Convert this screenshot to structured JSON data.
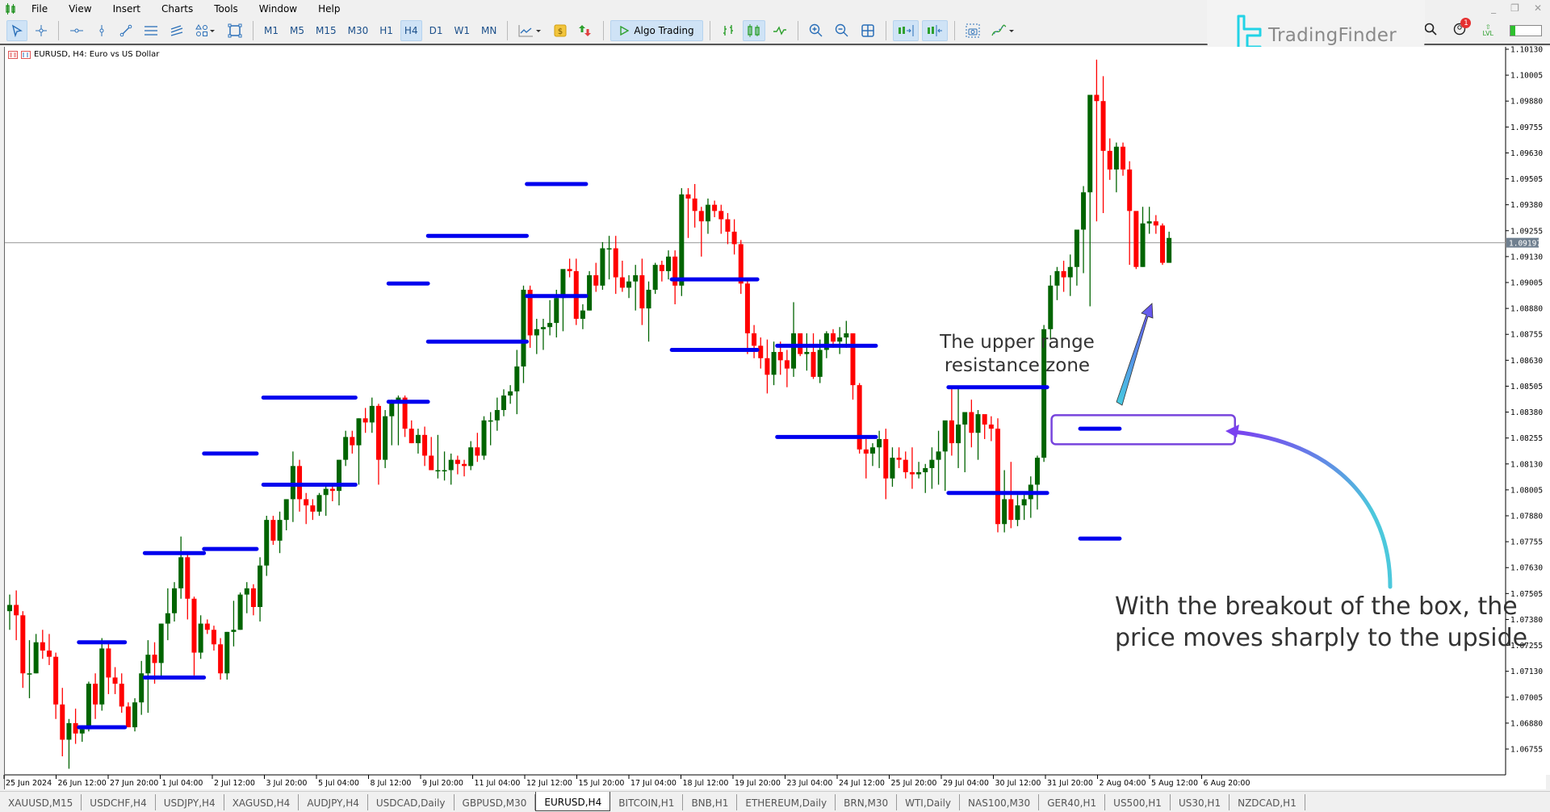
{
  "window": {
    "app_icon": "candles-app-icon",
    "menu": [
      "File",
      "View",
      "Insert",
      "Charts",
      "Tools",
      "Window",
      "Help"
    ],
    "controls": [
      "minimize",
      "restore",
      "close"
    ]
  },
  "toolbar": {
    "timeframes": [
      "M1",
      "M5",
      "M15",
      "M30",
      "H1",
      "H4",
      "D1",
      "W1",
      "MN"
    ],
    "active_timeframe": "H4",
    "algo_trading_label": "Algo Trading",
    "notification_count": "1",
    "level_label": "LVL",
    "level_fill": 0.15
  },
  "logo": {
    "text": "TradingFinder"
  },
  "chart": {
    "title": "EURUSD, H4:  Euro vs US Dollar",
    "current_price": "1.09197",
    "colors": {
      "bull": "#006400",
      "bear": "#ff0000",
      "range": "#0000ee",
      "box": "#7744dd",
      "price_line": "#a0a0a0"
    }
  },
  "chart_data": {
    "type": "candlestick",
    "symbol": "EURUSD",
    "timeframe": "H4",
    "ylim": [
      1.0663,
      1.1019
    ],
    "y_ticks": [
      "1.10130",
      "1.10005",
      "1.09880",
      "1.09755",
      "1.09630",
      "1.09505",
      "1.09380",
      "1.09255",
      "1.09130",
      "1.09005",
      "1.08880",
      "1.08755",
      "1.08630",
      "1.08505",
      "1.08380",
      "1.08255",
      "1.08130",
      "1.08005",
      "1.07880",
      "1.07755",
      "1.07630",
      "1.07505",
      "1.07380",
      "1.07255",
      "1.07130",
      "1.07005",
      "1.06880",
      "1.06755"
    ],
    "x_ticks": [
      "25 Jun 2024",
      "26 Jun 12:00",
      "27 Jun 20:00",
      "1 Jul 04:00",
      "2 Jul 12:00",
      "3 Jul 20:00",
      "5 Jul 04:00",
      "8 Jul 12:00",
      "9 Jul 20:00",
      "11 Jul 04:00",
      "12 Jul 12:00",
      "15 Jul 20:00",
      "17 Jul 04:00",
      "18 Jul 12:00",
      "19 Jul 20:00",
      "23 Jul 04:00",
      "24 Jul 12:00",
      "25 Jul 20:00",
      "29 Jul 04:00",
      "30 Jul 12:00",
      "31 Jul 20:00",
      "2 Aug 04:00",
      "5 Aug 12:00",
      "6 Aug 20:00"
    ],
    "candles": [
      [
        1.0742,
        1.075,
        1.0733,
        1.0745
      ],
      [
        1.0745,
        1.0752,
        1.0728,
        1.074
      ],
      [
        1.074,
        1.0742,
        1.0705,
        1.0712
      ],
      [
        1.0712,
        1.0728,
        1.07,
        1.0712
      ],
      [
        1.0712,
        1.0731,
        1.0712,
        1.0727
      ],
      [
        1.0727,
        1.0733,
        1.0719,
        1.0723
      ],
      [
        1.0723,
        1.0731,
        1.0716,
        1.072
      ],
      [
        1.072,
        1.0722,
        1.069,
        1.0697
      ],
      [
        1.0697,
        1.0705,
        1.0672,
        1.068
      ],
      [
        1.068,
        1.069,
        1.0666,
        1.0688
      ],
      [
        1.0688,
        1.0695,
        1.0678,
        1.0683
      ],
      [
        1.0683,
        1.0687,
        1.0679,
        1.0685
      ],
      [
        1.0685,
        1.0708,
        1.0684,
        1.0707
      ],
      [
        1.0707,
        1.0712,
        1.069,
        1.0697
      ],
      [
        1.0697,
        1.0729,
        1.0694,
        1.0724
      ],
      [
        1.0724,
        1.0727,
        1.0702,
        1.071
      ],
      [
        1.071,
        1.0715,
        1.0702,
        1.0707
      ],
      [
        1.0707,
        1.0712,
        1.0693,
        1.0696
      ],
      [
        1.0696,
        1.0698,
        1.0686,
        1.0686
      ],
      [
        1.0686,
        1.07,
        1.0684,
        1.0698
      ],
      [
        1.0698,
        1.0718,
        1.0692,
        1.0712
      ],
      [
        1.0712,
        1.0728,
        1.0693,
        1.0721
      ],
      [
        1.0721,
        1.0727,
        1.0707,
        1.0717
      ],
      [
        1.0717,
        1.0736,
        1.071,
        1.0736
      ],
      [
        1.0736,
        1.0753,
        1.0728,
        1.0741
      ],
      [
        1.0741,
        1.0756,
        1.0737,
        1.0753
      ],
      [
        1.0753,
        1.0778,
        1.0748,
        1.0768
      ],
      [
        1.0768,
        1.077,
        1.0738,
        1.0748
      ],
      [
        1.0748,
        1.0749,
        1.0711,
        1.0722
      ],
      [
        1.0722,
        1.074,
        1.0719,
        1.0736
      ],
      [
        1.0736,
        1.0738,
        1.0731,
        1.0733
      ],
      [
        1.0733,
        1.0735,
        1.0723,
        1.0726
      ],
      [
        1.0726,
        1.0729,
        1.0709,
        1.0712
      ],
      [
        1.0712,
        1.0732,
        1.0709,
        1.0732
      ],
      [
        1.0732,
        1.0747,
        1.0725,
        1.0733
      ],
      [
        1.0733,
        1.0751,
        1.0733,
        1.075
      ],
      [
        1.075,
        1.0756,
        1.0741,
        1.0753
      ],
      [
        1.0753,
        1.0755,
        1.074,
        1.0744
      ],
      [
        1.0744,
        1.0768,
        1.0737,
        1.0764
      ],
      [
        1.0764,
        1.0788,
        1.0759,
        1.0786
      ],
      [
        1.0786,
        1.0788,
        1.0774,
        1.0776
      ],
      [
        1.0776,
        1.079,
        1.077,
        1.0786
      ],
      [
        1.0786,
        1.0796,
        1.0781,
        1.0796
      ],
      [
        1.0796,
        1.0819,
        1.0785,
        1.0812
      ],
      [
        1.0812,
        1.0815,
        1.079,
        1.0796
      ],
      [
        1.0796,
        1.0799,
        1.0784,
        1.0793
      ],
      [
        1.0793,
        1.0796,
        1.0786,
        1.079
      ],
      [
        1.079,
        1.0799,
        1.0788,
        1.0798
      ],
      [
        1.0798,
        1.0802,
        1.0788,
        1.0801
      ],
      [
        1.0801,
        1.0803,
        1.0795,
        1.08
      ],
      [
        1.08,
        1.0815,
        1.0793,
        1.0815
      ],
      [
        1.0815,
        1.0829,
        1.0812,
        1.0826
      ],
      [
        1.0826,
        1.0829,
        1.0818,
        1.0822
      ],
      [
        1.0822,
        1.0835,
        1.0803,
        1.0835
      ],
      [
        1.0835,
        1.084,
        1.0828,
        1.0833
      ],
      [
        1.0833,
        1.0845,
        1.0828,
        1.0841
      ],
      [
        1.0841,
        1.0842,
        1.0803,
        1.0815
      ],
      [
        1.0815,
        1.0839,
        1.0811,
        1.0836
      ],
      [
        1.0836,
        1.0844,
        1.0822,
        1.0843
      ],
      [
        1.0843,
        1.0846,
        1.0822,
        1.0845
      ],
      [
        1.0845,
        1.0846,
        1.0826,
        1.083
      ],
      [
        1.083,
        1.0834,
        1.0823,
        1.0823
      ],
      [
        1.0823,
        1.083,
        1.0818,
        1.0827
      ],
      [
        1.0827,
        1.0831,
        1.0812,
        1.0817
      ],
      [
        1.0817,
        1.0826,
        1.081,
        1.081
      ],
      [
        1.081,
        1.0827,
        1.0806,
        1.081
      ],
      [
        1.081,
        1.0819,
        1.0805,
        1.081
      ],
      [
        1.081,
        1.0818,
        1.0803,
        1.0815
      ],
      [
        1.0815,
        1.0817,
        1.0808,
        1.0813
      ],
      [
        1.0813,
        1.0815,
        1.0807,
        1.0812
      ],
      [
        1.0812,
        1.0824,
        1.081,
        1.0821
      ],
      [
        1.0821,
        1.0828,
        1.0814,
        1.0817
      ],
      [
        1.0817,
        1.0836,
        1.0815,
        1.0834
      ],
      [
        1.0834,
        1.0838,
        1.0822,
        1.0834
      ],
      [
        1.0834,
        1.0845,
        1.0829,
        1.0839
      ],
      [
        1.0839,
        1.0849,
        1.0836,
        1.0846
      ],
      [
        1.0846,
        1.0851,
        1.0842,
        1.0848
      ],
      [
        1.0848,
        1.0868,
        1.0837,
        1.086
      ],
      [
        1.086,
        1.0899,
        1.0852,
        1.0897
      ],
      [
        1.0897,
        1.0899,
        1.0869,
        1.0875
      ],
      [
        1.0875,
        1.0883,
        1.0866,
        1.0878
      ],
      [
        1.0878,
        1.0883,
        1.0868,
        1.0879
      ],
      [
        1.0879,
        1.0892,
        1.0875,
        1.0881
      ],
      [
        1.0881,
        1.0897,
        1.0874,
        1.0893
      ],
      [
        1.0893,
        1.0903,
        1.0877,
        1.0907
      ],
      [
        1.0907,
        1.0912,
        1.0903,
        1.0906
      ],
      [
        1.0906,
        1.0912,
        1.088,
        1.0883
      ],
      [
        1.0883,
        1.089,
        1.0878,
        1.0887
      ],
      [
        1.0887,
        1.0906,
        1.0887,
        1.0904
      ],
      [
        1.0904,
        1.091,
        1.0896,
        1.0899
      ],
      [
        1.0899,
        1.092,
        1.0897,
        1.0917
      ],
      [
        1.0917,
        1.0923,
        1.0902,
        1.0917
      ],
      [
        1.0917,
        1.0923,
        1.0895,
        1.0903
      ],
      [
        1.0903,
        1.0911,
        1.0896,
        1.0898
      ],
      [
        1.0898,
        1.0904,
        1.0893,
        1.0901
      ],
      [
        1.0901,
        1.0909,
        1.0887,
        1.0904
      ],
      [
        1.0904,
        1.0912,
        1.088,
        1.0888
      ],
      [
        1.0888,
        1.0901,
        1.0872,
        1.0897
      ],
      [
        1.0897,
        1.091,
        1.0895,
        1.0909
      ],
      [
        1.0909,
        1.0911,
        1.0901,
        1.0906
      ],
      [
        1.0906,
        1.0916,
        1.0902,
        1.0913
      ],
      [
        1.0913,
        1.0916,
        1.089,
        1.0899
      ],
      [
        1.0899,
        1.0946,
        1.0894,
        1.0943
      ],
      [
        1.0943,
        1.0946,
        1.0922,
        1.0941
      ],
      [
        1.0941,
        1.0948,
        1.0927,
        1.0935
      ],
      [
        1.0935,
        1.0937,
        1.0913,
        1.093
      ],
      [
        1.093,
        1.0941,
        1.0924,
        1.0938
      ],
      [
        1.0938,
        1.094,
        1.0932,
        1.0935
      ],
      [
        1.0935,
        1.0938,
        1.0924,
        1.0931
      ],
      [
        1.0931,
        1.0934,
        1.0919,
        1.0925
      ],
      [
        1.0925,
        1.0931,
        1.0914,
        1.0919
      ],
      [
        1.0919,
        1.0921,
        1.0895,
        1.09
      ],
      [
        1.09,
        1.0902,
        1.0866,
        1.0876
      ],
      [
        1.0876,
        1.088,
        1.0864,
        1.087
      ],
      [
        1.087,
        1.0874,
        1.0859,
        1.0864
      ],
      [
        1.0864,
        1.0873,
        1.0847,
        1.0856
      ],
      [
        1.0856,
        1.0872,
        1.0851,
        1.0867
      ],
      [
        1.0867,
        1.0872,
        1.0856,
        1.0863
      ],
      [
        1.0863,
        1.0868,
        1.085,
        1.0859
      ],
      [
        1.0859,
        1.0891,
        1.0855,
        1.0876
      ],
      [
        1.0876,
        1.0876,
        1.0865,
        1.0866
      ],
      [
        1.0866,
        1.0876,
        1.0858,
        1.0867
      ],
      [
        1.0867,
        1.0876,
        1.0854,
        1.0855
      ],
      [
        1.0855,
        1.0873,
        1.0852,
        1.0868
      ],
      [
        1.0868,
        1.0877,
        1.0864,
        1.0876
      ],
      [
        1.0876,
        1.0878,
        1.0869,
        1.0872
      ],
      [
        1.0872,
        1.0879,
        1.0866,
        1.0874
      ],
      [
        1.0874,
        1.0882,
        1.0869,
        1.0876
      ],
      [
        1.0876,
        1.0876,
        1.0844,
        1.0851
      ],
      [
        1.0851,
        1.0852,
        1.0818,
        1.082
      ],
      [
        1.082,
        1.0825,
        1.0806,
        1.0818
      ],
      [
        1.0818,
        1.0823,
        1.0812,
        1.0821
      ],
      [
        1.0821,
        1.0829,
        1.0811,
        1.0825
      ],
      [
        1.0825,
        1.083,
        1.0796,
        1.0806
      ],
      [
        1.0806,
        1.0821,
        1.0802,
        1.0816
      ],
      [
        1.0816,
        1.0821,
        1.0811,
        1.0815
      ],
      [
        1.0815,
        1.0819,
        1.0806,
        1.0809
      ],
      [
        1.0809,
        1.0821,
        1.0801,
        1.0808
      ],
      [
        1.0808,
        1.0814,
        1.0806,
        1.0809
      ],
      [
        1.0809,
        1.0813,
        1.0799,
        1.0811
      ],
      [
        1.0811,
        1.0821,
        1.0801,
        1.0815
      ],
      [
        1.0815,
        1.0829,
        1.0803,
        1.0819
      ],
      [
        1.0819,
        1.0827,
        1.08,
        1.0834
      ],
      [
        1.0834,
        1.085,
        1.0817,
        1.0823
      ],
      [
        1.0823,
        1.085,
        1.0811,
        1.0832
      ],
      [
        1.0832,
        1.0837,
        1.0809,
        1.0838
      ],
      [
        1.0838,
        1.0844,
        1.0821,
        1.0828
      ],
      [
        1.0828,
        1.0839,
        1.0815,
        1.0837
      ],
      [
        1.0837,
        1.0833,
        1.0825,
        1.0832
      ],
      [
        1.0832,
        1.0836,
        1.0824,
        1.083
      ],
      [
        1.083,
        1.0835,
        1.078,
        1.0784
      ],
      [
        1.0784,
        1.081,
        1.078,
        1.0796
      ],
      [
        1.0796,
        1.0814,
        1.0782,
        1.0786
      ],
      [
        1.0786,
        1.0798,
        1.0783,
        1.0793
      ],
      [
        1.0793,
        1.0799,
        1.0786,
        1.0796
      ],
      [
        1.0796,
        1.0807,
        1.0787,
        1.0803
      ],
      [
        1.0803,
        1.0817,
        1.0791,
        1.0816
      ],
      [
        1.0816,
        1.088,
        1.0814,
        1.0878
      ],
      [
        1.0878,
        1.0904,
        1.0873,
        1.0899
      ],
      [
        1.0899,
        1.0908,
        1.0892,
        1.0906
      ],
      [
        1.0906,
        1.0911,
        1.0896,
        1.0903
      ],
      [
        1.0903,
        1.0914,
        1.0894,
        1.0908
      ],
      [
        1.0908,
        1.0922,
        1.0899,
        1.0926
      ],
      [
        1.0926,
        1.0947,
        1.0905,
        1.0944
      ],
      [
        1.0944,
        1.0986,
        1.0889,
        1.0991
      ],
      [
        1.0991,
        1.1008,
        1.093,
        1.0988
      ],
      [
        1.0988,
        1.1,
        1.0934,
        1.0964
      ],
      [
        1.0964,
        1.097,
        1.095,
        1.0955
      ],
      [
        1.0955,
        1.0968,
        1.0944,
        1.0966
      ],
      [
        1.0966,
        1.0968,
        1.0952,
        1.0955
      ],
      [
        1.0955,
        1.0959,
        1.0909,
        1.0935
      ],
      [
        1.0935,
        1.0934,
        1.0907,
        1.0908
      ],
      [
        1.0908,
        1.0937,
        1.0908,
        1.0929
      ],
      [
        1.0929,
        1.0937,
        1.0924,
        1.093
      ],
      [
        1.093,
        1.0933,
        1.0924,
        1.0928
      ],
      [
        1.0928,
        1.0929,
        1.0909,
        1.091
      ],
      [
        1.091,
        1.0925,
        1.091,
        1.0922
      ]
    ],
    "ranges": [
      {
        "from": 11,
        "to": 17,
        "high": 1.0727,
        "low": 1.0686
      },
      {
        "from": 21,
        "to": 29,
        "high": 1.077,
        "low": 1.071
      },
      {
        "from": 30,
        "to": 37,
        "high": 1.0818,
        "low": 1.0772
      },
      {
        "from": 39,
        "to": 52,
        "high": 1.0845,
        "low": 1.0803
      },
      {
        "from": 58,
        "to": 63,
        "high": 1.09,
        "low": 1.0843
      },
      {
        "from": 64,
        "to": 78,
        "high": 1.0923,
        "low": 1.0872
      },
      {
        "from": 79,
        "to": 87,
        "high": 1.0948,
        "low": 1.0894
      },
      {
        "from": 101,
        "to": 113,
        "high": 1.0902,
        "low": 1.0868
      },
      {
        "from": 117,
        "to": 131,
        "high": 1.087,
        "low": 1.0826
      },
      {
        "from": 143,
        "to": 157,
        "high": 1.085,
        "low": 1.0799
      },
      {
        "from": 163,
        "to": 168,
        "high": 1.083,
        "low": 1.0777
      }
    ],
    "breakout_box": {
      "from": 160,
      "to": 186,
      "high": 1.08365,
      "low": 1.08225
    },
    "current_price": 1.09197
  },
  "annotations": {
    "zone_label_line1": "The upper range",
    "zone_label_line2": "resistance zone",
    "breakout_line1": "With the breakout of the box, the",
    "breakout_line2": "price moves sharply to the upside"
  },
  "tabs": [
    "XAUUSD,M15",
    "USDCHF,H4",
    "USDJPY,H4",
    "XAGUSD,H4",
    "AUDJPY,H4",
    "USDCAD,Daily",
    "GBPUSD,M30",
    "EURUSD,H4",
    "BITCOIN,H1",
    "BNB,H1",
    "ETHEREUM,Daily",
    "BRN,M30",
    "WTI,Daily",
    "NAS100,M30",
    "GER40,H1",
    "US500,H1",
    "US30,H1",
    "NZDCAD,H1"
  ],
  "active_tab": "EURUSD,H4"
}
